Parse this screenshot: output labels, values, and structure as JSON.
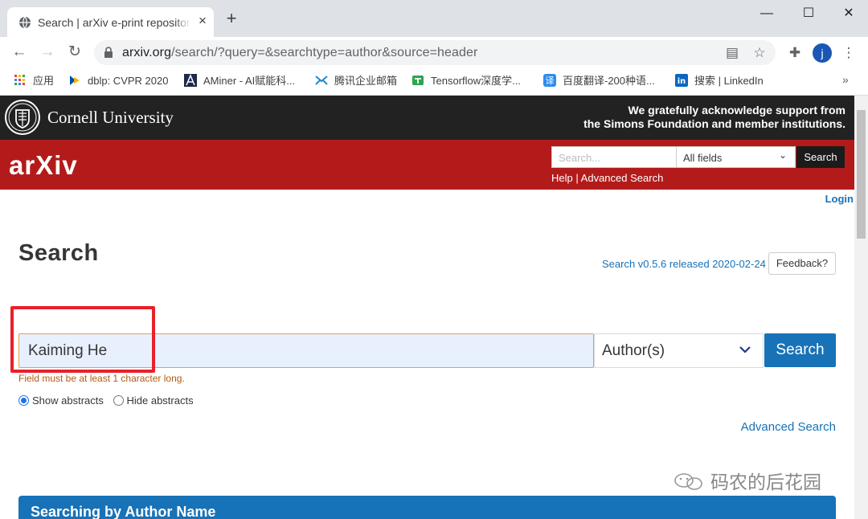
{
  "browser": {
    "tab_title": "Search | arXiv e-print repository",
    "url_host": "arxiv.org",
    "url_path": "/search/?query=&searchtype=author&source=header",
    "profile_initial": "j",
    "bookmarks": [
      {
        "label": "应用",
        "icon": "apps-grid-icon"
      },
      {
        "label": "dblp: CVPR 2020",
        "icon": "dblp-icon"
      },
      {
        "label": "AMiner - AI赋能科...",
        "icon": "aminer-icon"
      },
      {
        "label": "腾讯企业邮箱",
        "icon": "tencent-mail-icon"
      },
      {
        "label": "Tensorflow深度学...",
        "icon": "tensorflow-icon"
      },
      {
        "label": "百度翻译-200种语...",
        "icon": "baidu-translate-icon"
      },
      {
        "label": "搜索 | LinkedIn",
        "icon": "linkedin-icon"
      }
    ],
    "bookmarks_more": "»"
  },
  "header": {
    "university": "Cornell University",
    "ack_line1": "We gratefully acknowledge support from",
    "ack_line2": "the Simons Foundation and member institutions.",
    "logo": "arXiv",
    "search_placeholder": "Search...",
    "field_select": "All fields",
    "search_button": "Search",
    "help_link": "Help",
    "separator": "|",
    "advanced_link": "Advanced Search",
    "login": "Login"
  },
  "main": {
    "title": "Search",
    "version": "Search v0.5.6 released 2020-02-24",
    "feedback": "Feedback?",
    "query_value": "Kaiming He",
    "field_value": "Author(s)",
    "search_button": "Search",
    "help_text": "Field must be at least 1 character long.",
    "radio_show": "Show abstracts",
    "radio_hide": "Hide abstracts",
    "advanced_search": "Advanced Search",
    "info_title": "Searching by Author Name"
  },
  "watermark": "码农的后花园",
  "colors": {
    "arxiv_red": "#b31b1b",
    "cornell_black": "#222222",
    "link_blue": "#1772b7",
    "highlight_red": "#e8202a"
  }
}
